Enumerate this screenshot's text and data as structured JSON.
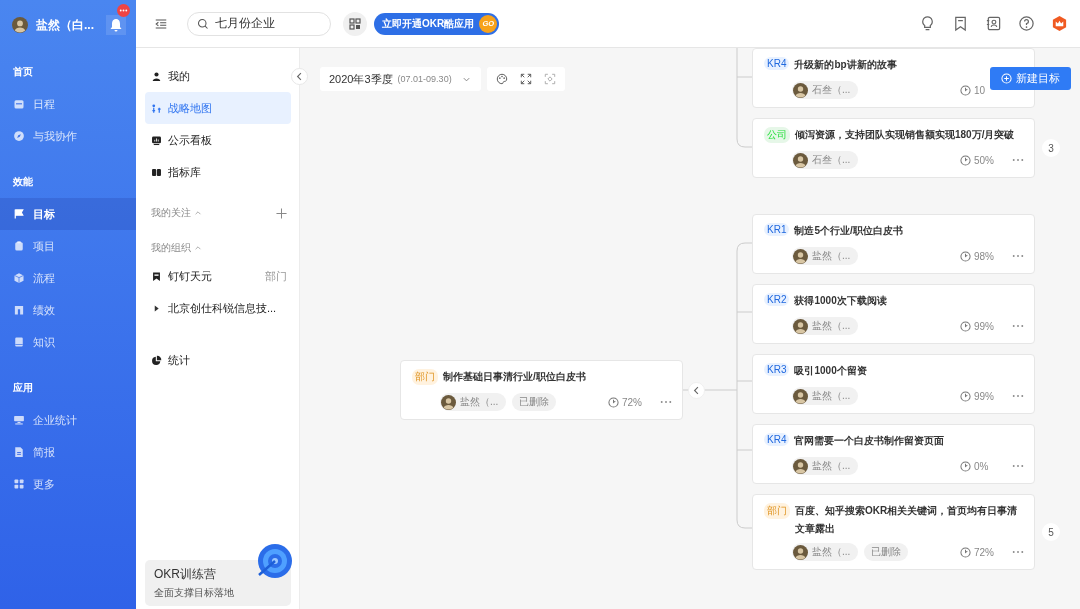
{
  "user": {
    "name": "盐然（白..."
  },
  "nav": [
    {
      "title": "首页",
      "items": [
        {
          "label": "日程",
          "selected": false
        },
        {
          "label": "与我协作",
          "selected": false
        }
      ]
    },
    {
      "title": "效能",
      "items": [
        {
          "label": "目标",
          "selected": true
        },
        {
          "label": "项目",
          "selected": false
        },
        {
          "label": "流程",
          "selected": false
        },
        {
          "label": "绩效",
          "selected": false
        },
        {
          "label": "知识",
          "selected": false
        }
      ]
    },
    {
      "title": "应用",
      "items": [
        {
          "label": "企业统计",
          "selected": false
        },
        {
          "label": "简报",
          "selected": false
        },
        {
          "label": "更多",
          "selected": false
        }
      ]
    }
  ],
  "search": {
    "value": "七月份企业"
  },
  "promo_button": {
    "label": "立即开通OKR酷应用",
    "badge": "GO"
  },
  "panel": {
    "items": [
      {
        "label": "我的",
        "selected": false
      },
      {
        "label": "战略地图",
        "selected": true
      },
      {
        "label": "公示看板",
        "selected": false
      },
      {
        "label": "指标库",
        "selected": false
      }
    ],
    "following": {
      "title": "我的关注",
      "expanded": true
    },
    "organization": {
      "title": "我的组织",
      "expanded": true,
      "items": [
        {
          "kind": "department",
          "label": "钉钉天元",
          "type": "部门"
        },
        {
          "kind": "tree",
          "label": "北京创仕科锐信息技...",
          "expanded": false
        }
      ]
    },
    "stats": {
      "label": "统计"
    },
    "promo_card": {
      "title": "OKR训练营",
      "subtitle": "全面支撑目标落地"
    }
  },
  "period": {
    "label": "2020年3季度",
    "range": "(07.01-09.30)"
  },
  "new_goal_button": {
    "label": "新建目标"
  },
  "main_card": {
    "tag": "部门",
    "color": "#fff2df",
    "title": "制作基础日事清行业/职位白皮书",
    "owner": "盐然（...",
    "status": "已删除",
    "progress": "72%",
    "more_menu": true
  },
  "branches": [
    {
      "cards": [
        {
          "tag": "KR4",
          "color": "#e8f1ff",
          "title": "升级新的bp讲新的故事",
          "owner": "石叁（...",
          "progress": "10",
          "more_menu": false
        },
        {
          "tag": "公司",
          "color": "#e6f7e8",
          "title": "倾泻资源，支持团队实现销售额实现180万/月突破",
          "owner": "石叁（...",
          "progress": "50%",
          "more_menu": true,
          "count": "3"
        }
      ]
    },
    {
      "cards": [
        {
          "tag": "KR1",
          "color": "#e8f1ff",
          "title": "制造5个行业/职位白皮书",
          "owner": "盐然（...",
          "progress": "98%",
          "more_menu": true
        },
        {
          "tag": "KR2",
          "color": "#e8f1ff",
          "title": "获得1000次下载阅读",
          "owner": "盐然（...",
          "progress": "99%",
          "more_menu": true
        },
        {
          "tag": "KR3",
          "color": "#e8f1ff",
          "title": "吸引1000个留资",
          "owner": "盐然（...",
          "progress": "99%",
          "more_menu": true
        },
        {
          "tag": "KR4",
          "color": "#e8f1ff",
          "title": "官网需要一个白皮书制作留资页面",
          "owner": "盐然（...",
          "progress": "0%",
          "more_menu": true
        },
        {
          "tag": "部门",
          "color": "#fff2df",
          "title": "百度、知乎搜索OKR相关关键词，首页均有日事清文章露出",
          "owner": "盐然（...",
          "status": "已删除",
          "progress": "72%",
          "more_menu": true,
          "count": "5"
        }
      ]
    }
  ]
}
